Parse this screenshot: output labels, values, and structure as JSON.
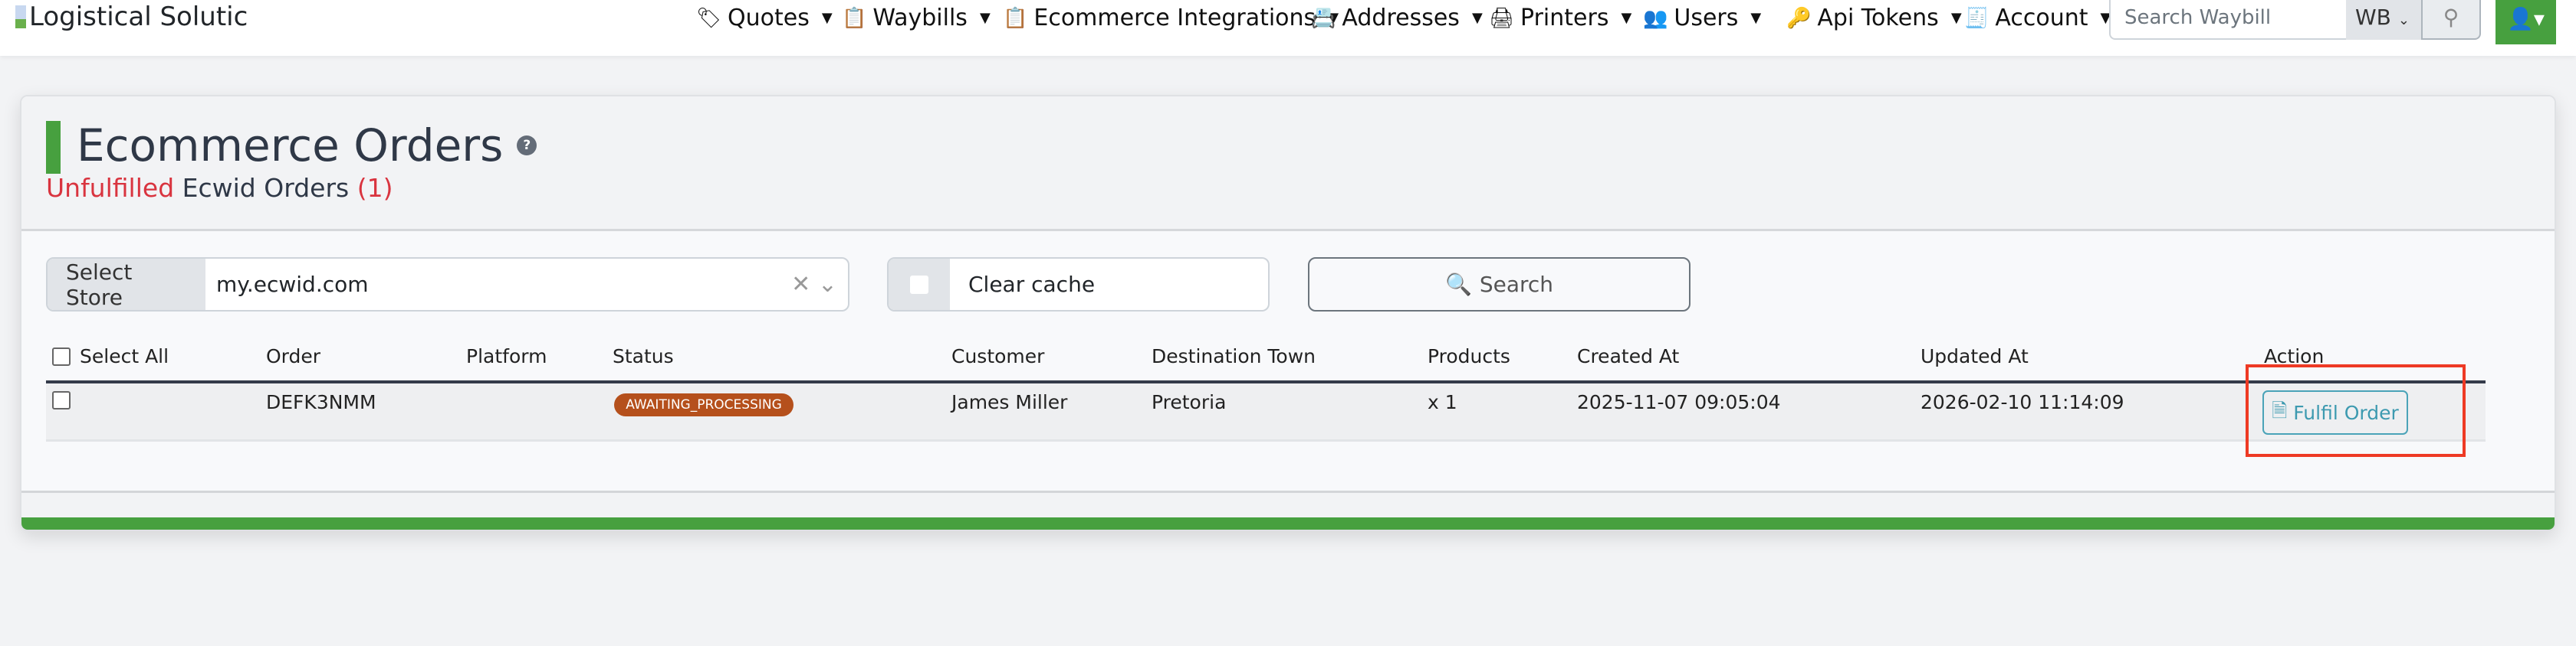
{
  "nav": {
    "logo_alt": "Logistical Solutic",
    "items": [
      {
        "label": "Quotes",
        "icon": "tag-icon"
      },
      {
        "label": "Waybills",
        "icon": "clipboard-icon"
      },
      {
        "label": "Ecommerce Integrations",
        "icon": "clipboard-icon"
      },
      {
        "label": "Addresses",
        "icon": "address-book-icon"
      },
      {
        "label": "Printers",
        "icon": "printer-icon"
      },
      {
        "label": "Users",
        "icon": "users-icon"
      },
      {
        "label": "Api Tokens",
        "icon": "key-icon"
      },
      {
        "label": "Account",
        "icon": "receipt-icon"
      }
    ],
    "search_placeholder": "Search Waybill",
    "search_type": "WB"
  },
  "page": {
    "title": "Ecommerce Orders",
    "sub_status": "Unfulfilled",
    "sub_text": "Ecwid Orders",
    "sub_count": "(1)"
  },
  "filters": {
    "store_label": "Select Store",
    "store_value": "my.ecwid.com",
    "clear_cache_label": "Clear cache",
    "search_label": "Search"
  },
  "table": {
    "headers": [
      "Select All",
      "Order",
      "Platform",
      "Status",
      "Customer",
      "Destination Town",
      "Products",
      "Created At",
      "Updated At",
      "Action"
    ],
    "rows": [
      {
        "order": "DEFK3NMM",
        "platform": "",
        "status": "AWAITING_PROCESSING",
        "customer": "James Miller",
        "town": "Pretoria",
        "products": "x 1",
        "created": "2025-11-07 09:05:04",
        "updated": "2026-02-10 11:14:09",
        "action": "Fulfil Order"
      }
    ]
  },
  "colors": {
    "accent": "#47a03f",
    "danger": "#d9343f",
    "status": "#b5501c",
    "info": "#3d9ab0"
  }
}
